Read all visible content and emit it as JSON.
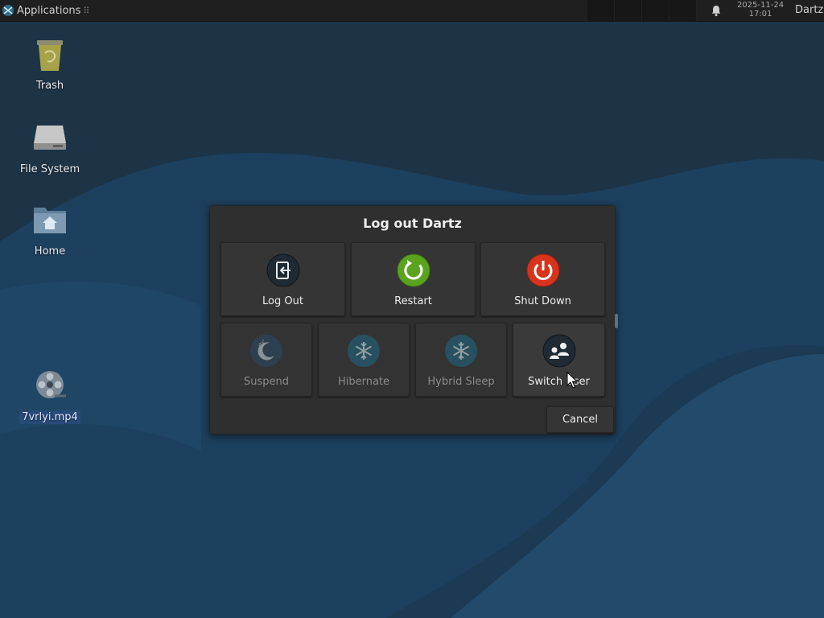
{
  "panel": {
    "apps_label": "Applications",
    "apps_separator": "⠿",
    "clock_date": "2025-11-24",
    "clock_time": "17:01",
    "user": "Dartz",
    "icons": {
      "logo": "xfce-logo-icon",
      "notifications": "bell-icon"
    }
  },
  "desktop": {
    "icons": [
      {
        "label": "Trash",
        "icon": "trash-icon"
      },
      {
        "label": "File System",
        "icon": "drive-icon"
      },
      {
        "label": "Home",
        "icon": "home-folder-icon"
      },
      {
        "label": "7vrlyi.mp4",
        "icon": "video-reel-icon",
        "selected": true
      }
    ]
  },
  "dialog": {
    "title": "Log out Dartz",
    "actions_row1": [
      {
        "label": "Log Out",
        "icon": "logout-icon",
        "enabled": true
      },
      {
        "label": "Restart",
        "icon": "restart-icon",
        "enabled": true,
        "color": "#5aa31f"
      },
      {
        "label": "Shut Down",
        "icon": "power-icon",
        "enabled": true,
        "color": "#d8341b"
      }
    ],
    "actions_row2": [
      {
        "label": "Suspend",
        "icon": "moon-sleep-icon",
        "enabled": false
      },
      {
        "label": "Hibernate",
        "icon": "snowflake-icon",
        "enabled": false
      },
      {
        "label": "Hybrid Sleep",
        "icon": "snowflake-icon",
        "enabled": false
      },
      {
        "label": "Switch User",
        "icon": "switch-user-icon",
        "enabled": true
      }
    ],
    "cancel_label": "Cancel"
  }
}
